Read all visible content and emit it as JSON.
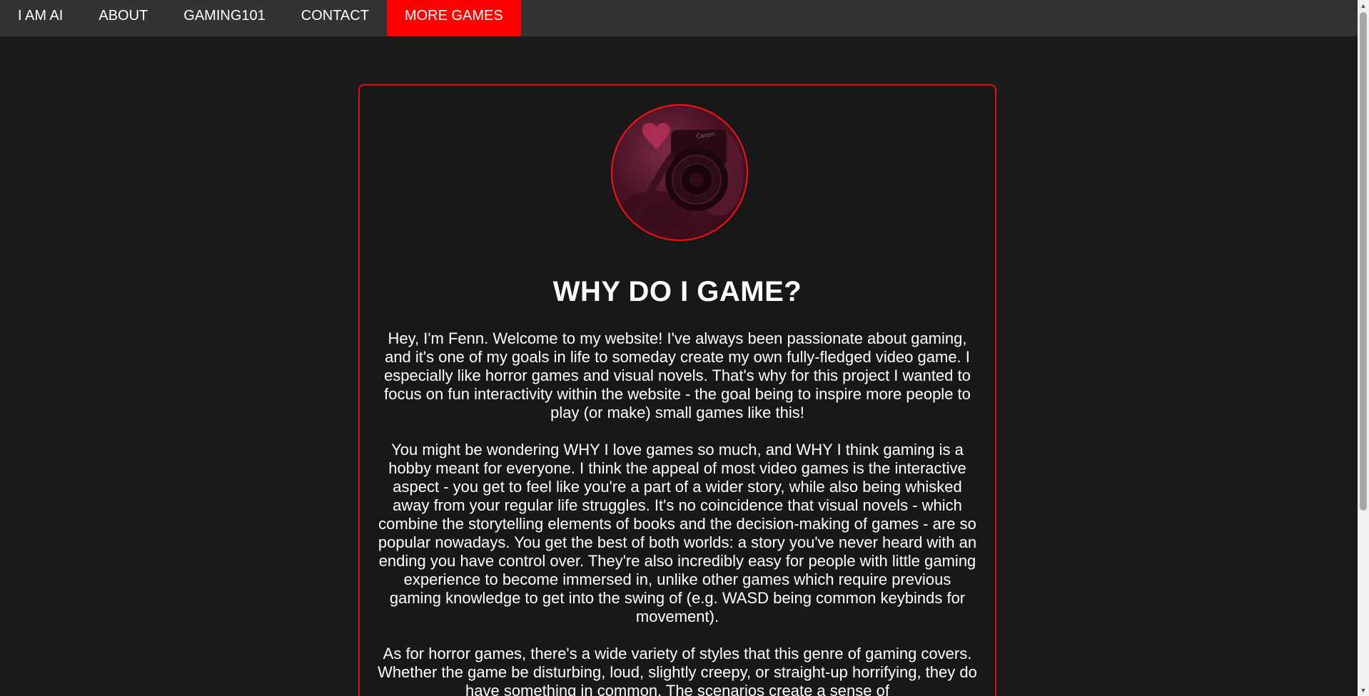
{
  "nav": {
    "items": [
      {
        "label": "I AM AI"
      },
      {
        "label": "ABOUT"
      },
      {
        "label": "GAMING101"
      },
      {
        "label": "CONTACT"
      },
      {
        "label": "MORE GAMES"
      }
    ],
    "active_index": 4,
    "active_color": "#ff0000",
    "bar_color": "#333333"
  },
  "card": {
    "title": "WHY DO I GAME?",
    "avatar_icon": "camera-photo",
    "border_color": "#e01010",
    "paragraphs": [
      "Hey, I'm Fenn. Welcome to my website! I've always been passionate about gaming, and it's one of my goals in life to someday create my own fully-fledged video game. I especially like horror games and visual novels. That's why for this project I wanted to focus on fun interactivity within the website - the goal being to inspire more people to play (or make) small games like this!",
      "You might be wondering WHY I love games so much, and WHY I think gaming is a hobby meant for everyone. I think the appeal of most video games is the interactive aspect - you get to feel like you're a part of a wider story, while also being whisked away from your regular life struggles. It's no coincidence that visual novels - which combine the storytelling elements of books and the decision-making of games - are so popular nowadays. You get the best of both worlds: a story you've never heard with an ending you have control over. They're also incredibly easy for people with little gaming experience to become immersed in, unlike other games which require previous gaming knowledge to get into the swing of (e.g. WASD being common keybinds for movement).",
      "As for horror games, there's a wide variety of styles that this genre of gaming covers. Whether the game be disturbing, loud, slightly creepy, or straight-up horrifying, they do have something in common. The scenarios create a sense of"
    ]
  },
  "colors": {
    "page_background": "#1b1b1b",
    "text": "#ffffff"
  }
}
